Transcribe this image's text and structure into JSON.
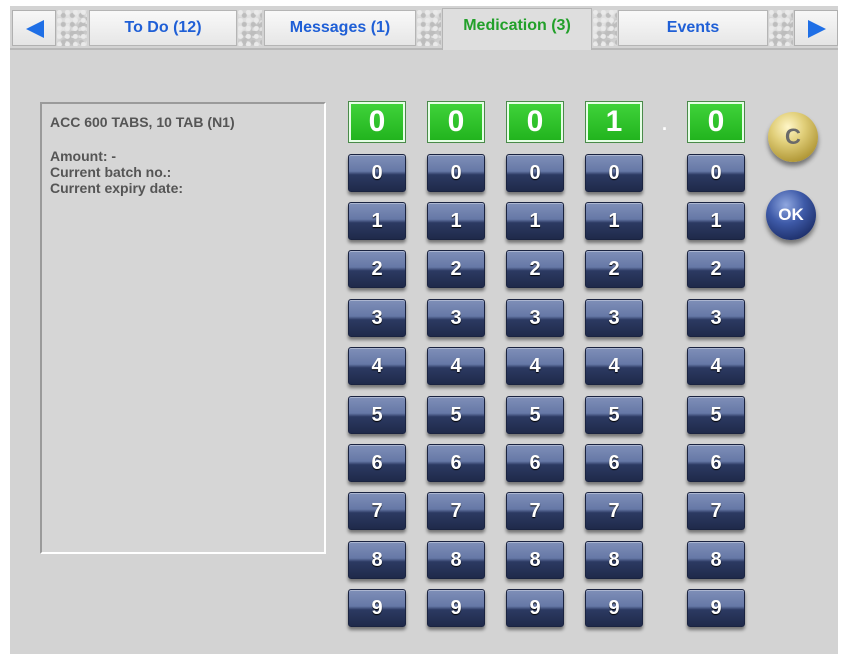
{
  "tabs": {
    "todo": "To Do (12)",
    "messages": "Messages (1)",
    "medication": "Medication (3)",
    "events": "Events"
  },
  "info": {
    "product": "ACC 600 TABS, 10 TAB (N1)",
    "amount": "Amount: -",
    "batch": "Current batch no.:",
    "expiry": "Current expiry date:"
  },
  "display": {
    "digit1": "0",
    "digit2": "0",
    "digit3": "0",
    "digit4": "1",
    "separator": ".",
    "digit5": "0"
  },
  "keypad": {
    "k0": "0",
    "k1": "1",
    "k2": "2",
    "k3": "3",
    "k4": "4",
    "k5": "5",
    "k6": "6",
    "k7": "7",
    "k8": "8",
    "k9": "9"
  },
  "buttons": {
    "clear": "C",
    "ok": "OK"
  },
  "colors": {
    "tab_text": "#1f5fd6",
    "tab_active_text": "#22a02a",
    "display_green": "#2fc22a",
    "key_blue": "#3a4a78",
    "clear_gold": "#d4bf63",
    "ok_blue": "#2a3f88"
  },
  "icons": {
    "prev": "arrow-left-icon",
    "next": "arrow-right-icon"
  }
}
